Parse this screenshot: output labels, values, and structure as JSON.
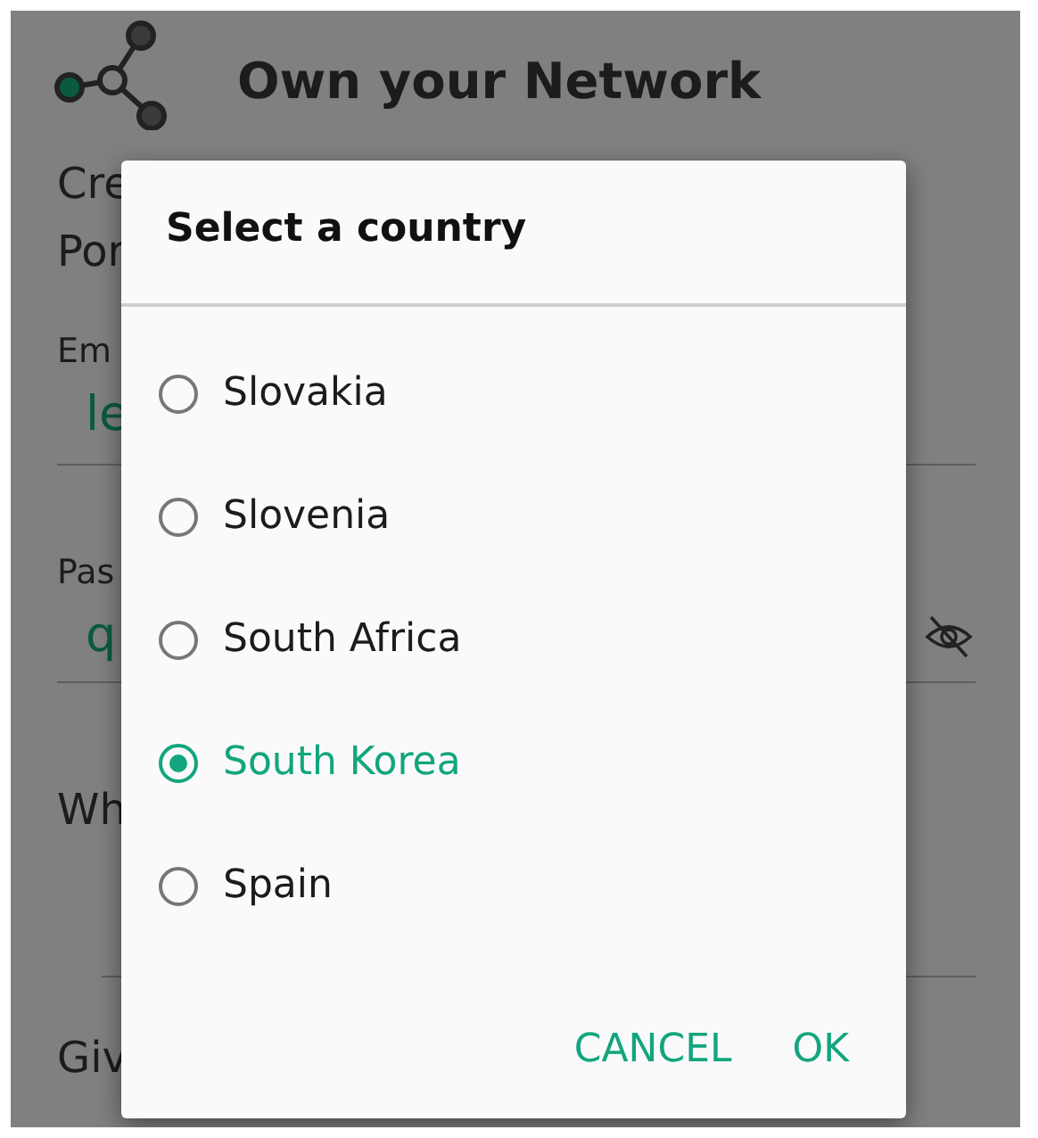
{
  "page": {
    "title": "Own your Network",
    "intro": [
      "Cre",
      "Por"
    ],
    "fields": [
      {
        "kind": "text",
        "label": "Em",
        "value": "le"
      },
      {
        "kind": "password",
        "label": "Pas",
        "value": "q"
      }
    ],
    "questions": [
      "Wh",
      "Giv"
    ]
  },
  "dialog": {
    "title": "Select a country",
    "options": [
      {
        "label": "Slovakia",
        "selected": false
      },
      {
        "label": "Slovenia",
        "selected": false
      },
      {
        "label": "South Africa",
        "selected": false
      },
      {
        "label": "South Korea",
        "selected": true
      },
      {
        "label": "Spain",
        "selected": false
      }
    ],
    "buttons": [
      "CANCEL",
      "OK"
    ]
  }
}
